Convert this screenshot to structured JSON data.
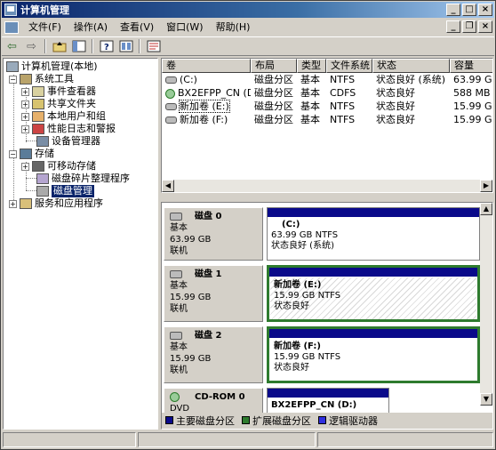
{
  "window": {
    "title": "计算机管理"
  },
  "menu": [
    "文件(F)",
    "操作(A)",
    "查看(V)",
    "窗口(W)",
    "帮助(H)"
  ],
  "tree": {
    "root": "计算机管理(本地)",
    "system_tools": "系统工具",
    "event_viewer": "事件查看器",
    "shared_folders": "共享文件夹",
    "local_users": "本地用户和组",
    "perf_logs": "性能日志和警报",
    "device_manager": "设备管理器",
    "storage": "存储",
    "removable": "可移动存储",
    "defrag": "磁盘碎片整理程序",
    "disk_mgmt": "磁盘管理",
    "services": "服务和应用程序"
  },
  "volume_list": {
    "columns": [
      "卷",
      "布局",
      "类型",
      "文件系统",
      "状态",
      "容量"
    ],
    "rows": [
      {
        "volume": "(C:)",
        "layout": "磁盘分区",
        "type": "基本",
        "fs": "NTFS",
        "status": "状态良好 (系统)",
        "capacity": "63.99 GB",
        "icon": "volume-icon"
      },
      {
        "volume": "BX2EFPP_CN (D:)",
        "layout": "磁盘分区",
        "type": "基本",
        "fs": "CDFS",
        "status": "状态良好",
        "capacity": "588 MB",
        "icon": "cdrom-icon"
      },
      {
        "volume": "新加卷 (E:)",
        "layout": "磁盘分区",
        "type": "基本",
        "fs": "NTFS",
        "status": "状态良好",
        "capacity": "15.99 GB",
        "icon": "volume-icon"
      },
      {
        "volume": "新加卷 (F:)",
        "layout": "磁盘分区",
        "type": "基本",
        "fs": "NTFS",
        "status": "状态良好",
        "capacity": "15.99 GB",
        "icon": "volume-icon"
      }
    ]
  },
  "disks": [
    {
      "name": "磁盘 0",
      "type": "基本",
      "size": "63.99 GB",
      "state": "联机",
      "part": {
        "name": "(C:)",
        "size_fs": "63.99 GB NTFS",
        "status": "状态良好 (系统)"
      }
    },
    {
      "name": "磁盘 1",
      "type": "基本",
      "size": "15.99 GB",
      "state": "联机",
      "part": {
        "name": "新加卷  (E:)",
        "size_fs": "15.99 GB NTFS",
        "status": "状态良好"
      }
    },
    {
      "name": "磁盘 2",
      "type": "基本",
      "size": "15.99 GB",
      "state": "联机",
      "part": {
        "name": "新加卷  (F:)",
        "size_fs": "15.99 GB NTFS",
        "status": "状态良好"
      }
    },
    {
      "name": "CD-ROM 0",
      "type": "DVD",
      "size": "",
      "state": "",
      "part": {
        "name": "BX2EFPP_CN  (D:)",
        "size_fs": "",
        "status": ""
      }
    }
  ],
  "legend": {
    "primary": "主要磁盘分区",
    "extended": "扩展磁盘分区",
    "logical": "逻辑驱动器",
    "colors": {
      "primary": "#0a0a8a",
      "extended": "#2e7b2e",
      "logical": "#3030e0"
    }
  }
}
